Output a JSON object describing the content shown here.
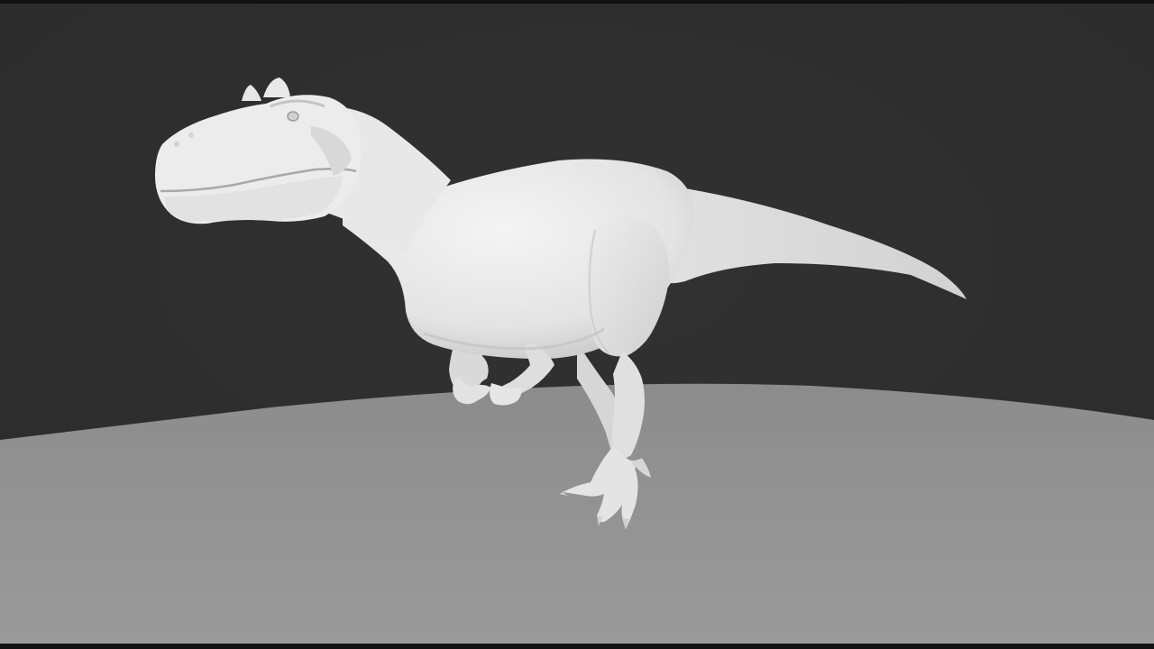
{
  "scene": {
    "subject": "dinosaur-sculpt",
    "colors": {
      "background": "#2b2b2b",
      "floor": "#9a9a9a",
      "floor_far": "#8c8c8c",
      "model": "#e9e9e9",
      "model_shadow": "#bdbdbd",
      "letterbox": "#111111"
    }
  }
}
